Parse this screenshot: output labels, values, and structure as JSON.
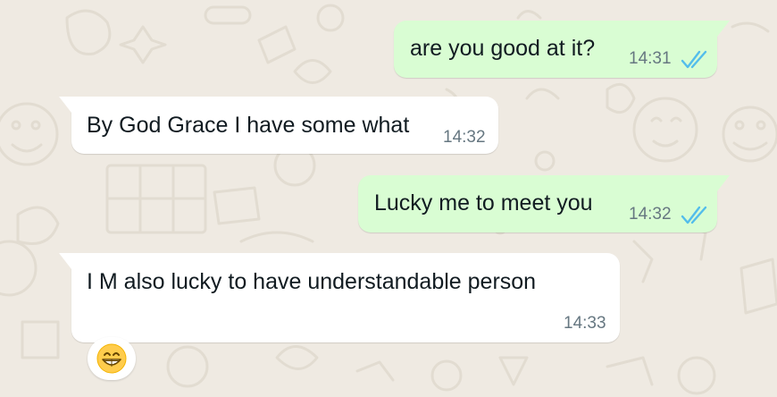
{
  "messages": [
    {
      "direction": "outgoing",
      "text": "are you good at it?",
      "time": "14:31",
      "status": "read"
    },
    {
      "direction": "incoming",
      "text": "By God Grace I have some what",
      "time": "14:32"
    },
    {
      "direction": "outgoing",
      "text": "Lucky me to meet you",
      "time": "14:32",
      "status": "read"
    },
    {
      "direction": "incoming",
      "text": "I M also lucky to have understandable person",
      "time": "14:33",
      "reaction": {
        "emoji": "grinning-face-with-smiling-eyes",
        "icon": "grin-emoji-icon"
      }
    }
  ],
  "colors": {
    "background": "#efeae2",
    "outgoing_bubble": "#d9fdd3",
    "incoming_bubble": "#ffffff",
    "read_tick": "#53bdeb",
    "timestamp": "#667781"
  }
}
